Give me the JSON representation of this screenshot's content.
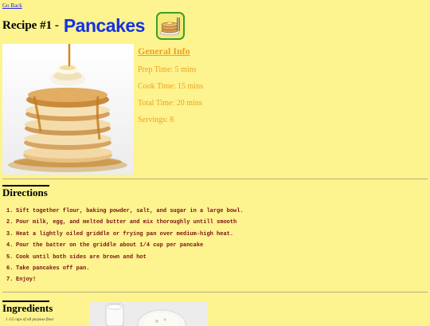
{
  "nav": {
    "back_label": "Go Back"
  },
  "recipe": {
    "prefix": "Recipe #1 - ",
    "name": "Pancakes"
  },
  "general_info": {
    "heading": "General Info",
    "lines": [
      "Prep Time: 5 mins",
      "Cook Time: 15 mins",
      "Total Time: 20 mins",
      "Servings: 8"
    ]
  },
  "directions": {
    "heading": "Directions",
    "steps": [
      {
        "num": "1.",
        "text": "Sift together flour, baking powder, salt, and sugar in a large bowl."
      },
      {
        "num": "2.",
        "text": "Pour milk, egg, and melted butter and mix thoroughly untill smooth"
      },
      {
        "num": "3.",
        "text": "Heat a lightly oiled griddle or frying pan over medium-high heat."
      },
      {
        "num": "4.",
        "text": "Pour the batter on the griddle about 1/4 cup per pancake"
      },
      {
        "num": "5.",
        "text": "Cook until both sides are brown and hot"
      },
      {
        "num": "6.",
        "text": "Take pancakes off pan."
      },
      {
        "num": "7.",
        "text": "Enjoy!"
      }
    ]
  },
  "ingredients": {
    "heading": "Ingredients",
    "first_item": "1 1/2 cups of all purpose flour"
  },
  "colors": {
    "background": "#fdf38f",
    "title_blue": "#1430e6",
    "info_orange": "#f0a020",
    "directions_red": "#7a1212",
    "icon_border": "#38a02a"
  },
  "icons": {
    "recipe_icon": "pancake-stack-icon"
  }
}
